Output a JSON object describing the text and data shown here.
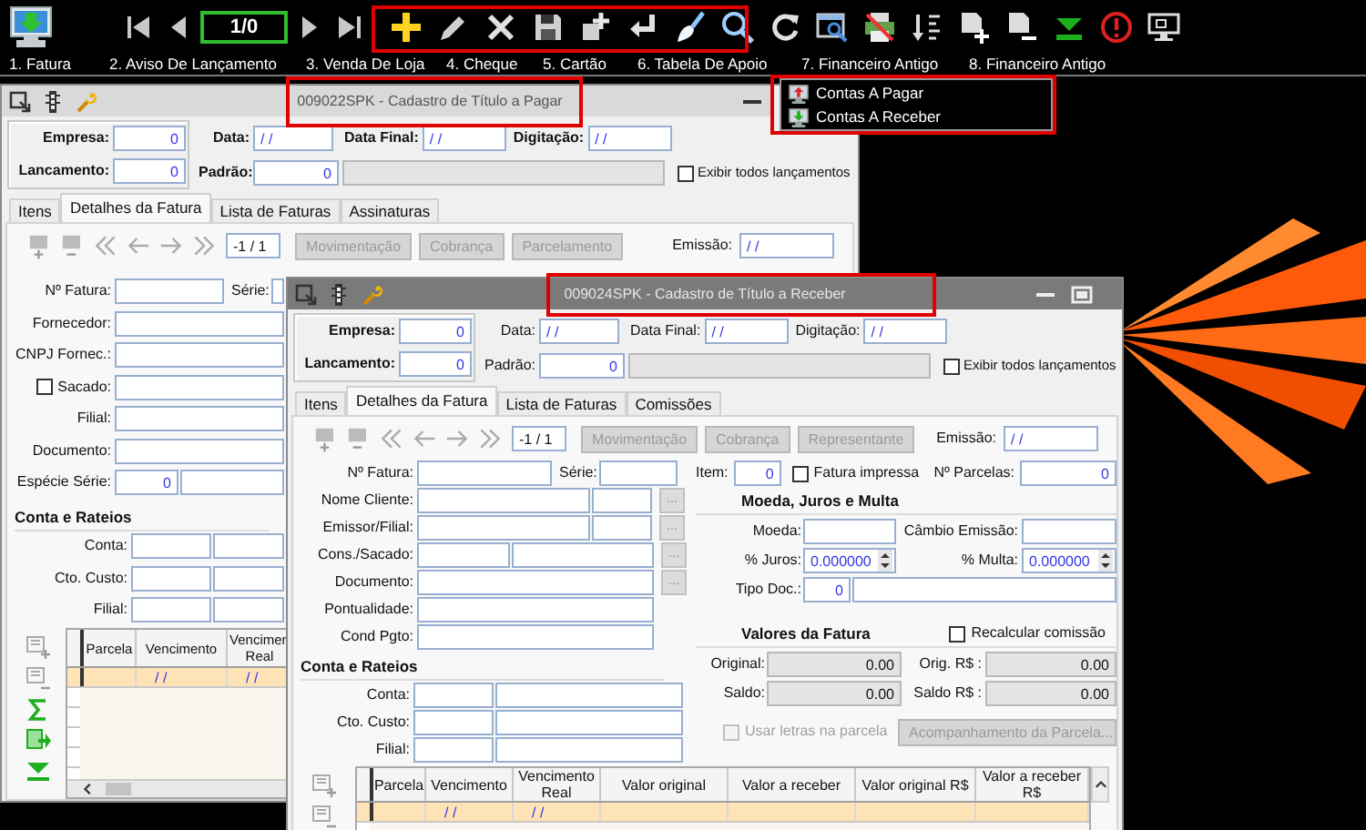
{
  "toolbar": {
    "record_counter": "1/0"
  },
  "menu_bar": [
    {
      "label": "1. Fatura"
    },
    {
      "label": "2. Aviso De Lançamento"
    },
    {
      "label": "3. Venda De Loja"
    },
    {
      "label": "4. Cheque"
    },
    {
      "label": "5. Cartão"
    },
    {
      "label": "6. Tabela De Apoio"
    },
    {
      "label": "7. Financeiro Antigo"
    },
    {
      "label": "8. Financeiro Antigo"
    }
  ],
  "dropdown": [
    {
      "label": "Contas A Pagar",
      "kind": "payable"
    },
    {
      "label": "Contas A Receber",
      "kind": "receivable"
    }
  ],
  "windows": [
    {
      "kind": "payable",
      "active": false,
      "title": "009022SPK - Cadastro de Título a Pagar",
      "header": {
        "empresa": {
          "label": "Empresa:",
          "value": "0"
        },
        "lancamento": {
          "label": "Lancamento:",
          "value": "0"
        },
        "data": {
          "label": "Data:",
          "value": "/ /"
        },
        "data_final": {
          "label": "Data Final:",
          "value": "/ /"
        },
        "digitacao": {
          "label": "Digitação:",
          "value": "/ /"
        },
        "padrao": {
          "label": "Padrão:",
          "value": "0"
        },
        "show_all": {
          "label": "Exibir todos lançamentos",
          "checked": false
        }
      },
      "tabs": [
        {
          "label": "Itens",
          "selected": false
        },
        {
          "label": "Detalhes da Fatura",
          "selected": true
        },
        {
          "label": "Lista de Faturas",
          "selected": false
        },
        {
          "label": "Assinaturas",
          "selected": false
        }
      ],
      "nav": {
        "page": "-1 / 1",
        "buttons": [
          {
            "label": "Movimentação",
            "disabled": true
          },
          {
            "label": "Cobrança",
            "disabled": true
          },
          {
            "label": "Parcelamento",
            "disabled": true
          }
        ],
        "emissao": {
          "label": "Emissão:",
          "value": "/ /"
        }
      },
      "fields": [
        {
          "label": "Nº Fatura:",
          "kind": "short",
          "extra_label": "Série:"
        },
        {
          "label": "Fornecedor:",
          "kind": "long"
        },
        {
          "label": "CNPJ Fornec.:",
          "kind": "long"
        },
        {
          "label": "Sacado:",
          "kind": "check",
          "checked": false
        },
        {
          "label": "Filial:",
          "kind": "long"
        },
        {
          "label": "Documento:",
          "kind": "long"
        },
        {
          "label": "Espécie Série:",
          "kind": "number",
          "value": "0"
        }
      ],
      "accounts": {
        "heading": "Conta e Rateios",
        "rows": [
          {
            "label": "Conta:"
          },
          {
            "label": "Cto. Custo:"
          },
          {
            "label": "Filial:"
          }
        ]
      },
      "grid": {
        "columns": [
          "Parcela",
          "Vencimento",
          "Vencimen Real"
        ],
        "rows": [
          {
            "selected": true,
            "vencimento": "/ /",
            "vencimento_real": "/ /"
          }
        ]
      }
    },
    {
      "kind": "receivable",
      "active": true,
      "title": "009024SPK - Cadastro de Título a Receber",
      "header": {
        "empresa": {
          "label": "Empresa:",
          "value": "0"
        },
        "lancamento": {
          "label": "Lancamento:",
          "value": "0"
        },
        "data": {
          "label": "Data:",
          "value": "/ /"
        },
        "data_final": {
          "label": "Data Final:",
          "value": "/ /"
        },
        "digitacao": {
          "label": "Digitação:",
          "value": "/ /"
        },
        "padrao": {
          "label": "Padrão:",
          "value": "0"
        },
        "show_all": {
          "label": "Exibir todos lançamentos",
          "checked": false
        }
      },
      "tabs": [
        {
          "label": "Itens",
          "selected": false
        },
        {
          "label": "Detalhes da Fatura",
          "selected": true
        },
        {
          "label": "Lista de Faturas",
          "selected": false
        },
        {
          "label": "Comissões",
          "selected": false
        }
      ],
      "nav": {
        "page": "-1 / 1",
        "buttons": [
          {
            "label": "Movimentação",
            "disabled": true
          },
          {
            "label": "Cobrança",
            "disabled": true
          },
          {
            "label": "Representante",
            "disabled": true
          }
        ],
        "emissao": {
          "label": "Emissão:",
          "value": "/ /"
        }
      },
      "fields": [
        {
          "label": "Nº Fatura:",
          "kind": "short",
          "extra_label": "Série:"
        },
        {
          "label": "Nome Cliente:",
          "kind": "code-name",
          "button": "..."
        },
        {
          "label": "Emissor/Filial:",
          "kind": "code-name",
          "button": "..."
        },
        {
          "label": "Cons./Sacado:",
          "kind": "name-code",
          "button": "..."
        },
        {
          "label": "Documento:",
          "kind": "single",
          "button": "..."
        },
        {
          "label": "Pontualidade:",
          "kind": "single"
        },
        {
          "label": "Cond Pgto:",
          "kind": "single"
        }
      ],
      "details": {
        "item": {
          "label": "Item:",
          "value": "0"
        },
        "printed": {
          "label": "Fatura impressa",
          "checked": false
        },
        "installments": {
          "label": "Nº Parcelas:",
          "value": "0"
        },
        "currency_heading": "Moeda, Juros e Multa",
        "moeda": {
          "label": "Moeda:"
        },
        "cambio": {
          "label": "Câmbio Emissão:"
        },
        "juros": {
          "label": "% Juros:",
          "value": "0.000000"
        },
        "multa": {
          "label": "% Multa:",
          "value": "0.000000"
        },
        "tipo_doc": {
          "label": "Tipo Doc.:",
          "value": "0"
        },
        "totals_heading": "Valores da Fatura",
        "recalc": {
          "label": "Recalcular comissão",
          "checked": false
        },
        "original": {
          "label": "Original:",
          "value": "0.00"
        },
        "orig_rs": {
          "label": "Orig. R$ :",
          "value": "0.00"
        },
        "saldo": {
          "label": "Saldo:",
          "value": "0.00"
        },
        "saldo_rs": {
          "label": "Saldo R$ :",
          "value": "0.00"
        },
        "use_letters": {
          "label": "Usar letras na parcela",
          "checked": false,
          "disabled": true
        },
        "tracking": {
          "label": "Acompanhamento da Parcela...",
          "disabled": true
        }
      },
      "accounts": {
        "heading": "Conta e Rateios",
        "rows": [
          {
            "label": "Conta:"
          },
          {
            "label": "Cto. Custo:"
          },
          {
            "label": "Filial:"
          }
        ]
      },
      "grid": {
        "columns": [
          "Parcela",
          "Vencimento",
          "Vencimento Real",
          "Valor original",
          "Valor a receber",
          "Valor original R$",
          "Valor a receber R$"
        ],
        "rows": [
          {
            "selected": true,
            "vencimento": "/ /",
            "vencimento_real": "/ /"
          }
        ]
      }
    }
  ]
}
